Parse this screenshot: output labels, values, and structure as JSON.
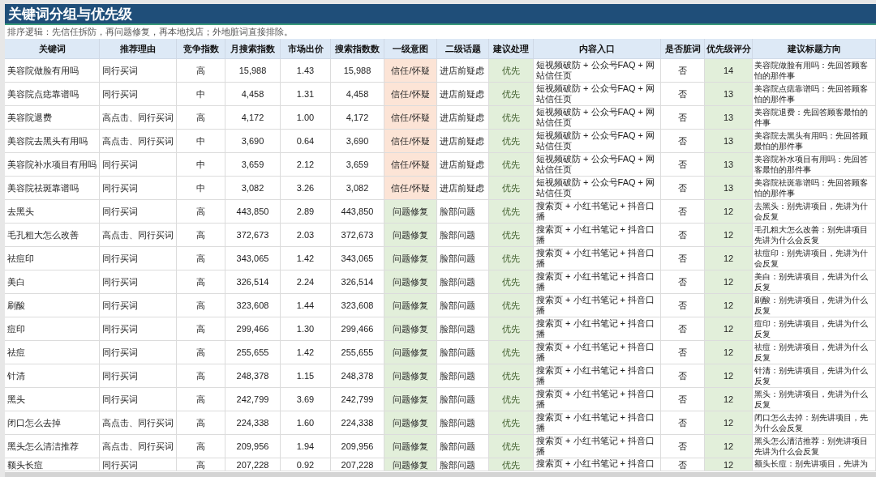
{
  "title": "关键词分组与优先级",
  "subtitle": "排序逻辑：先信任拆防，再问题修复，再本地找店；外地脏词直接排除。",
  "columns": [
    "关键词",
    "推荐理由",
    "竞争指数",
    "月搜索指数",
    "市场出价",
    "搜索指数数",
    "一级意图",
    "二级话题",
    "建议处理",
    "内容入口",
    "是否脏词",
    "优先级评分",
    "建议标题方向"
  ],
  "rows": [
    {
      "keyword": "美容院做脸有用吗",
      "reason": "同行买词",
      "competition": "高",
      "monthly": "15,988",
      "bid": "1.43",
      "index_value": "15,988",
      "intent": {
        "text": "信任/怀疑",
        "color": "#fce4d6"
      },
      "topic": "进店前疑虑",
      "action": "优先",
      "entry": [
        "短视频破防 + 公众号FAQ + 网",
        "站信任页"
      ],
      "dirty": "否",
      "score": "14",
      "title_direction": [
        "美容院做脸有用吗：先回答顾客",
        "怕的那件事"
      ]
    },
    {
      "keyword": "美容院点痣靠谱吗",
      "reason": "同行买词",
      "competition": "中",
      "monthly": "4,458",
      "bid": "1.31",
      "index_value": "4,458",
      "intent": {
        "text": "信任/怀疑",
        "color": "#fce4d6"
      },
      "topic": "进店前疑虑",
      "action": "优先",
      "entry": [
        "短视频破防 + 公众号FAQ + 网",
        "站信任页"
      ],
      "dirty": "否",
      "score": "13",
      "title_direction": [
        "美容院点痣靠谱吗：先回答顾客",
        "怕的那件事"
      ]
    },
    {
      "keyword": "美容院退费",
      "reason": "高点击、同行买词",
      "competition": "高",
      "monthly": "4,172",
      "bid": "1.00",
      "index_value": "4,172",
      "intent": {
        "text": "信任/怀疑",
        "color": "#fce4d6"
      },
      "topic": "进店前疑虑",
      "action": "优先",
      "entry": [
        "短视频破防 + 公众号FAQ + 网",
        "站信任页"
      ],
      "dirty": "否",
      "score": "13",
      "title_direction": [
        "美容院退费：先回答顾客最怕的",
        "件事"
      ]
    },
    {
      "keyword": "美容院去黑头有用吗",
      "reason": "高点击、同行买词",
      "competition": "中",
      "monthly": "3,690",
      "bid": "0.64",
      "index_value": "3,690",
      "intent": {
        "text": "信任/怀疑",
        "color": "#fce4d6"
      },
      "topic": "进店前疑虑",
      "action": "优先",
      "entry": [
        "短视频破防 + 公众号FAQ + 网",
        "站信任页"
      ],
      "dirty": "否",
      "score": "13",
      "title_direction": [
        "美容院去黑头有用吗：先回答顾",
        "最怕的那件事"
      ]
    },
    {
      "keyword": "美容院补水项目有用吗",
      "reason": "同行买词",
      "competition": "中",
      "monthly": "3,659",
      "bid": "2.12",
      "index_value": "3,659",
      "intent": {
        "text": "信任/怀疑",
        "color": "#fce4d6"
      },
      "topic": "进店前疑虑",
      "action": "优先",
      "entry": [
        "短视频破防 + 公众号FAQ + 网",
        "站信任页"
      ],
      "dirty": "否",
      "score": "13",
      "title_direction": [
        "美容院补水项目有用吗：先回答",
        "客最怕的那件事"
      ]
    },
    {
      "keyword": "美容院祛斑靠谱吗",
      "reason": "同行买词",
      "competition": "中",
      "monthly": "3,082",
      "bid": "3.26",
      "index_value": "3,082",
      "intent": {
        "text": "信任/怀疑",
        "color": "#fce4d6"
      },
      "topic": "进店前疑虑",
      "action": "优先",
      "entry": [
        "短视频破防 + 公众号FAQ + 网",
        "站信任页"
      ],
      "dirty": "否",
      "score": "13",
      "title_direction": [
        "美容院祛斑靠谱吗：先回答顾客",
        "怕的那件事"
      ]
    },
    {
      "keyword": "去黑头",
      "reason": "同行买词",
      "competition": "高",
      "monthly": "443,850",
      "bid": "2.89",
      "index_value": "443,850",
      "intent": {
        "text": "问题修复",
        "color": "#e2efda"
      },
      "topic": "脸部问题",
      "action": "优先",
      "entry": [
        "搜索页 + 小红书笔记 + 抖音口",
        "播"
      ],
      "dirty": "否",
      "score": "12",
      "title_direction": [
        "去黑头：别先讲项目，先讲为什",
        "会反复"
      ]
    },
    {
      "keyword": "毛孔粗大怎么改善",
      "reason": "高点击、同行买词",
      "competition": "高",
      "monthly": "372,673",
      "bid": "2.03",
      "index_value": "372,673",
      "intent": {
        "text": "问题修复",
        "color": "#e2efda"
      },
      "topic": "脸部问题",
      "action": "优先",
      "entry": [
        "搜索页 + 小红书笔记 + 抖音口",
        "播"
      ],
      "dirty": "否",
      "score": "12",
      "title_direction": [
        "毛孔粗大怎么改善：别先讲项目",
        "先讲为什么会反复"
      ]
    },
    {
      "keyword": "祛痘印",
      "reason": "同行买词",
      "competition": "高",
      "monthly": "343,065",
      "bid": "1.42",
      "index_value": "343,065",
      "intent": {
        "text": "问题修复",
        "color": "#e2efda"
      },
      "topic": "脸部问题",
      "action": "优先",
      "entry": [
        "搜索页 + 小红书笔记 + 抖音口",
        "播"
      ],
      "dirty": "否",
      "score": "12",
      "title_direction": [
        "祛痘印：别先讲项目，先讲为什",
        "会反复"
      ]
    },
    {
      "keyword": "美白",
      "reason": "同行买词",
      "competition": "高",
      "monthly": "326,514",
      "bid": "2.24",
      "index_value": "326,514",
      "intent": {
        "text": "问题修复",
        "color": "#e2efda"
      },
      "topic": "脸部问题",
      "action": "优先",
      "entry": [
        "搜索页 + 小红书笔记 + 抖音口",
        "播"
      ],
      "dirty": "否",
      "score": "12",
      "title_direction": [
        "美白：别先讲项目，先讲为什么",
        "反复"
      ]
    },
    {
      "keyword": "刷酸",
      "reason": "同行买词",
      "competition": "高",
      "monthly": "323,608",
      "bid": "1.44",
      "index_value": "323,608",
      "intent": {
        "text": "问题修复",
        "color": "#e2efda"
      },
      "topic": "脸部问题",
      "action": "优先",
      "entry": [
        "搜索页 + 小红书笔记 + 抖音口",
        "播"
      ],
      "dirty": "否",
      "score": "12",
      "title_direction": [
        "刷酸：别先讲项目，先讲为什么",
        "反复"
      ]
    },
    {
      "keyword": "痘印",
      "reason": "同行买词",
      "competition": "高",
      "monthly": "299,466",
      "bid": "1.30",
      "index_value": "299,466",
      "intent": {
        "text": "问题修复",
        "color": "#e2efda"
      },
      "topic": "脸部问题",
      "action": "优先",
      "entry": [
        "搜索页 + 小红书笔记 + 抖音口",
        "播"
      ],
      "dirty": "否",
      "score": "12",
      "title_direction": [
        "痘印：别先讲项目，先讲为什么",
        "反复"
      ]
    },
    {
      "keyword": "祛痘",
      "reason": "同行买词",
      "competition": "高",
      "monthly": "255,655",
      "bid": "1.42",
      "index_value": "255,655",
      "intent": {
        "text": "问题修复",
        "color": "#e2efda"
      },
      "topic": "脸部问题",
      "action": "优先",
      "entry": [
        "搜索页 + 小红书笔记 + 抖音口",
        "播"
      ],
      "dirty": "否",
      "score": "12",
      "title_direction": [
        "祛痘：别先讲项目，先讲为什么",
        "反复"
      ]
    },
    {
      "keyword": "针清",
      "reason": "同行买词",
      "competition": "高",
      "monthly": "248,378",
      "bid": "1.15",
      "index_value": "248,378",
      "intent": {
        "text": "问题修复",
        "color": "#e2efda"
      },
      "topic": "脸部问题",
      "action": "优先",
      "entry": [
        "搜索页 + 小红书笔记 + 抖音口",
        "播"
      ],
      "dirty": "否",
      "score": "12",
      "title_direction": [
        "针清：别先讲项目，先讲为什么",
        "反复"
      ]
    },
    {
      "keyword": "黑头",
      "reason": "同行买词",
      "competition": "高",
      "monthly": "242,799",
      "bid": "3.69",
      "index_value": "242,799",
      "intent": {
        "text": "问题修复",
        "color": "#e2efda"
      },
      "topic": "脸部问题",
      "action": "优先",
      "entry": [
        "搜索页 + 小红书笔记 + 抖音口",
        "播"
      ],
      "dirty": "否",
      "score": "12",
      "title_direction": [
        "黑头：别先讲项目，先讲为什么",
        "反复"
      ]
    },
    {
      "keyword": "闭口怎么去掉",
      "reason": "高点击、同行买词",
      "competition": "高",
      "monthly": "224,338",
      "bid": "1.60",
      "index_value": "224,338",
      "intent": {
        "text": "问题修复",
        "color": "#e2efda"
      },
      "topic": "脸部问题",
      "action": "优先",
      "entry": [
        "搜索页 + 小红书笔记 + 抖音口",
        "播"
      ],
      "dirty": "否",
      "score": "12",
      "title_direction": [
        "闭口怎么去掉：别先讲项目，先",
        "为什么会反复"
      ]
    },
    {
      "keyword": "黑头怎么清洁推荐",
      "reason": "高点击、同行买词",
      "competition": "高",
      "monthly": "209,956",
      "bid": "1.94",
      "index_value": "209,956",
      "intent": {
        "text": "问题修复",
        "color": "#e2efda"
      },
      "topic": "脸部问题",
      "action": "优先",
      "entry": [
        "搜索页 + 小红书笔记 + 抖音口",
        "播"
      ],
      "dirty": "否",
      "score": "12",
      "title_direction": [
        "黑头怎么清洁推荐：别先讲项目",
        "先讲为什么会反复"
      ]
    },
    {
      "keyword": "额头长痘",
      "reason": "同行买词",
      "competition": "高",
      "monthly": "207,228",
      "bid": "0.92",
      "index_value": "207,228",
      "intent": {
        "text": "问题修复",
        "color": "#e2efda"
      },
      "topic": "脸部问题",
      "action": "优先",
      "entry": [
        "搜索页 + 小红书笔记 + 抖音口"
      ],
      "dirty": "否",
      "score": "12",
      "title_direction": [
        "额头长痘：别先讲项目，先讲为"
      ]
    }
  ]
}
